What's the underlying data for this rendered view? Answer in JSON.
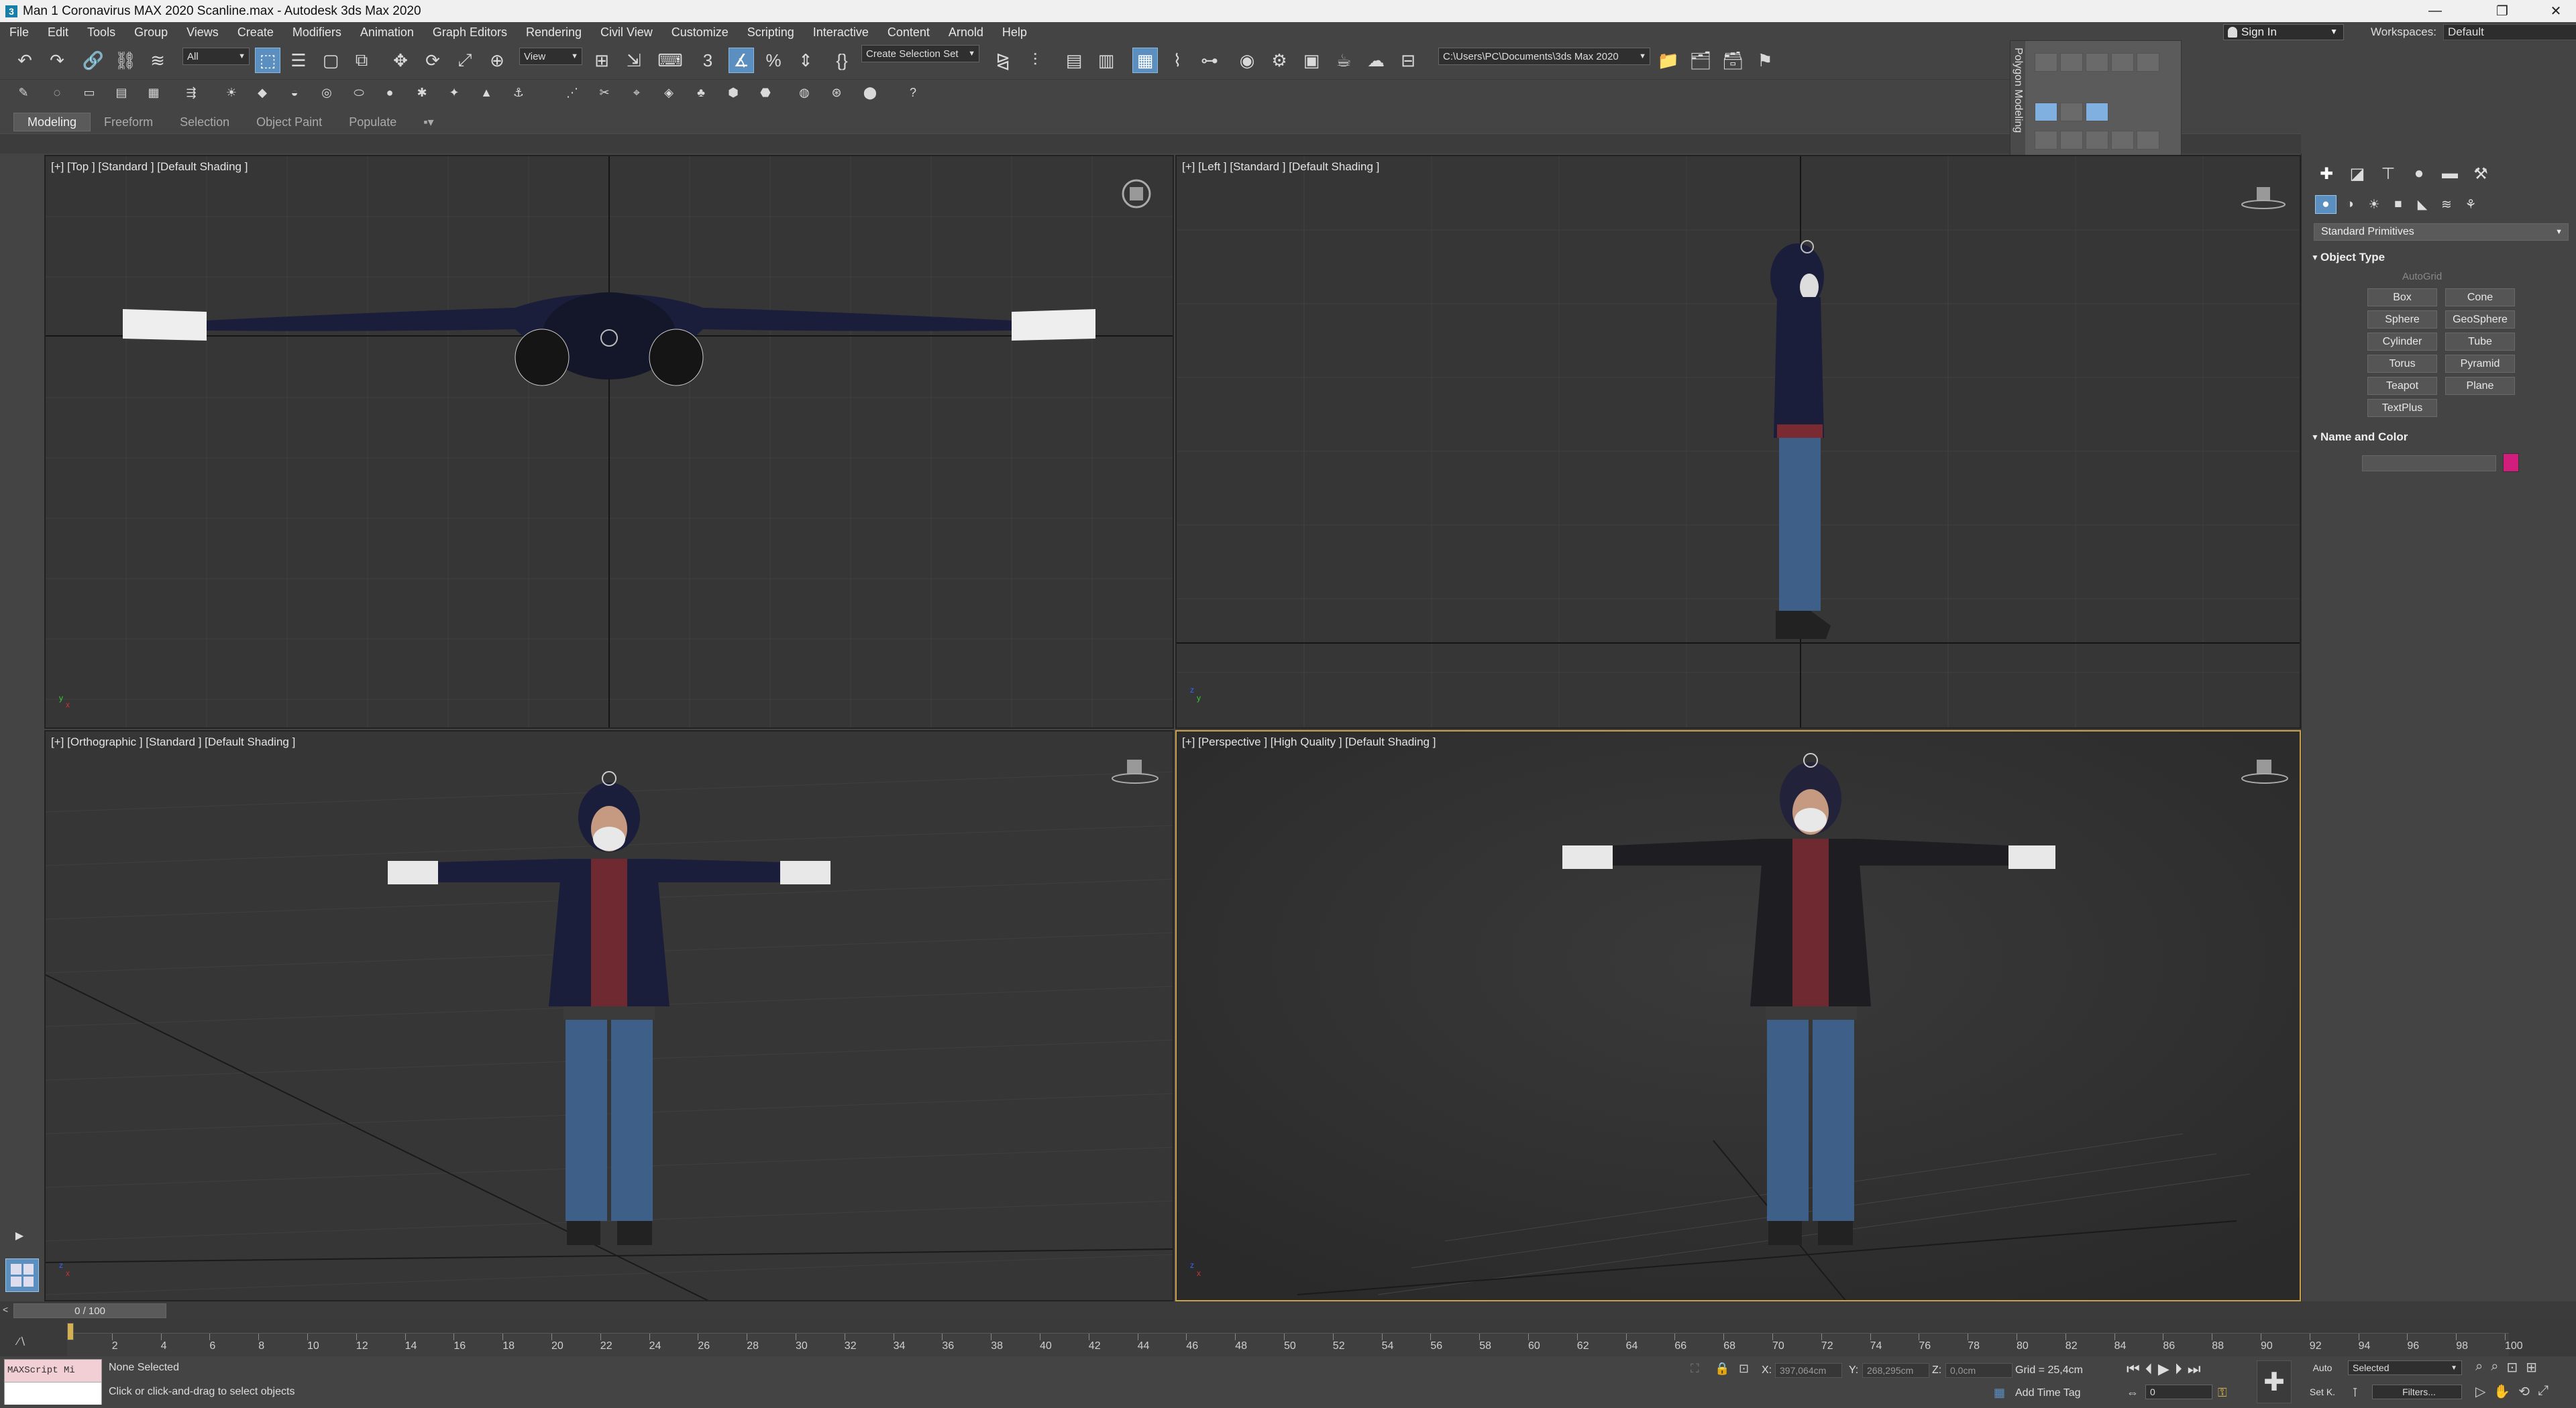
{
  "window": {
    "title": "Man 1 Coronavirus MAX 2020 Scanline.max - Autodesk 3ds Max 2020",
    "app_icon": "3",
    "minimize": "—",
    "maximize": "❐",
    "close": "✕"
  },
  "menu": [
    "File",
    "Edit",
    "Tools",
    "Group",
    "Views",
    "Create",
    "Modifiers",
    "Animation",
    "Graph Editors",
    "Rendering",
    "Civil View",
    "Customize",
    "Scripting",
    "Interactive",
    "Content",
    "Arnold",
    "Help"
  ],
  "account": {
    "sign_in": "Sign In",
    "workspaces_label": "Workspaces:",
    "workspace_value": "Default"
  },
  "toolbar": {
    "selection_filter": "All",
    "reference_coord": "View",
    "create_selection_set": "Create Selection Set",
    "project_path": "C:\\Users\\PC\\Documents\\3ds Max 2020"
  },
  "ribbon": {
    "tabs": [
      "Modeling",
      "Freeform",
      "Selection",
      "Object Paint",
      "Populate"
    ],
    "active": "Modeling"
  },
  "polygon_modeling": {
    "label": "Polygon Modeling"
  },
  "viewports": [
    {
      "label": "[+] [Top ] [Standard ] [Default Shading ]"
    },
    {
      "label": "[+] [Left ] [Standard ] [Default Shading ]"
    },
    {
      "label": "[+] [Orthographic ] [Standard ] [Default Shading ]"
    },
    {
      "label": "[+] [Perspective ] [High Quality ] [Default Shading ]"
    }
  ],
  "command_panel": {
    "dropdown": "Standard Primitives",
    "object_type_title": "Object Type",
    "autogrid": "AutoGrid",
    "buttons": [
      "Box",
      "Cone",
      "Sphere",
      "GeoSphere",
      "Cylinder",
      "Tube",
      "Torus",
      "Pyramid",
      "Teapot",
      "Plane",
      "TextPlus"
    ],
    "name_color_title": "Name and Color",
    "object_color": "#d11e7c"
  },
  "timeline": {
    "frame_display": "0 / 100",
    "ticks": [
      "0",
      "2",
      "4",
      "6",
      "8",
      "10",
      "12",
      "14",
      "16",
      "18",
      "20",
      "22",
      "24",
      "26",
      "28",
      "30",
      "32",
      "34",
      "36",
      "38",
      "40",
      "42",
      "44",
      "46",
      "48",
      "50",
      "52",
      "54",
      "56",
      "58",
      "60",
      "62",
      "64",
      "66",
      "68",
      "70",
      "72",
      "74",
      "76",
      "78",
      "80",
      "82",
      "84",
      "86",
      "88",
      "90",
      "92",
      "94",
      "96",
      "98",
      "100"
    ]
  },
  "status": {
    "maxscript_line1": "MAXScript Mi",
    "maxscript_line2": "",
    "selection": "None Selected",
    "prompt": "Click or click-and-drag to select objects",
    "x_label": "X:",
    "x_value": "397,064cm",
    "y_label": "Y:",
    "y_value": "268,295cm",
    "z_label": "Z:",
    "z_value": "0,0cm",
    "grid": "Grid = 25,4cm",
    "add_time_tag": "Add Time Tag",
    "auto_key": "Auto",
    "set_key": "Set K.",
    "key_mode": "Selected",
    "filters": "Filters...",
    "current_frame": "0"
  },
  "colors": {
    "viewport_bg": "#363636",
    "active_border": "#c8a14a",
    "accent": "#5b8fc0"
  }
}
